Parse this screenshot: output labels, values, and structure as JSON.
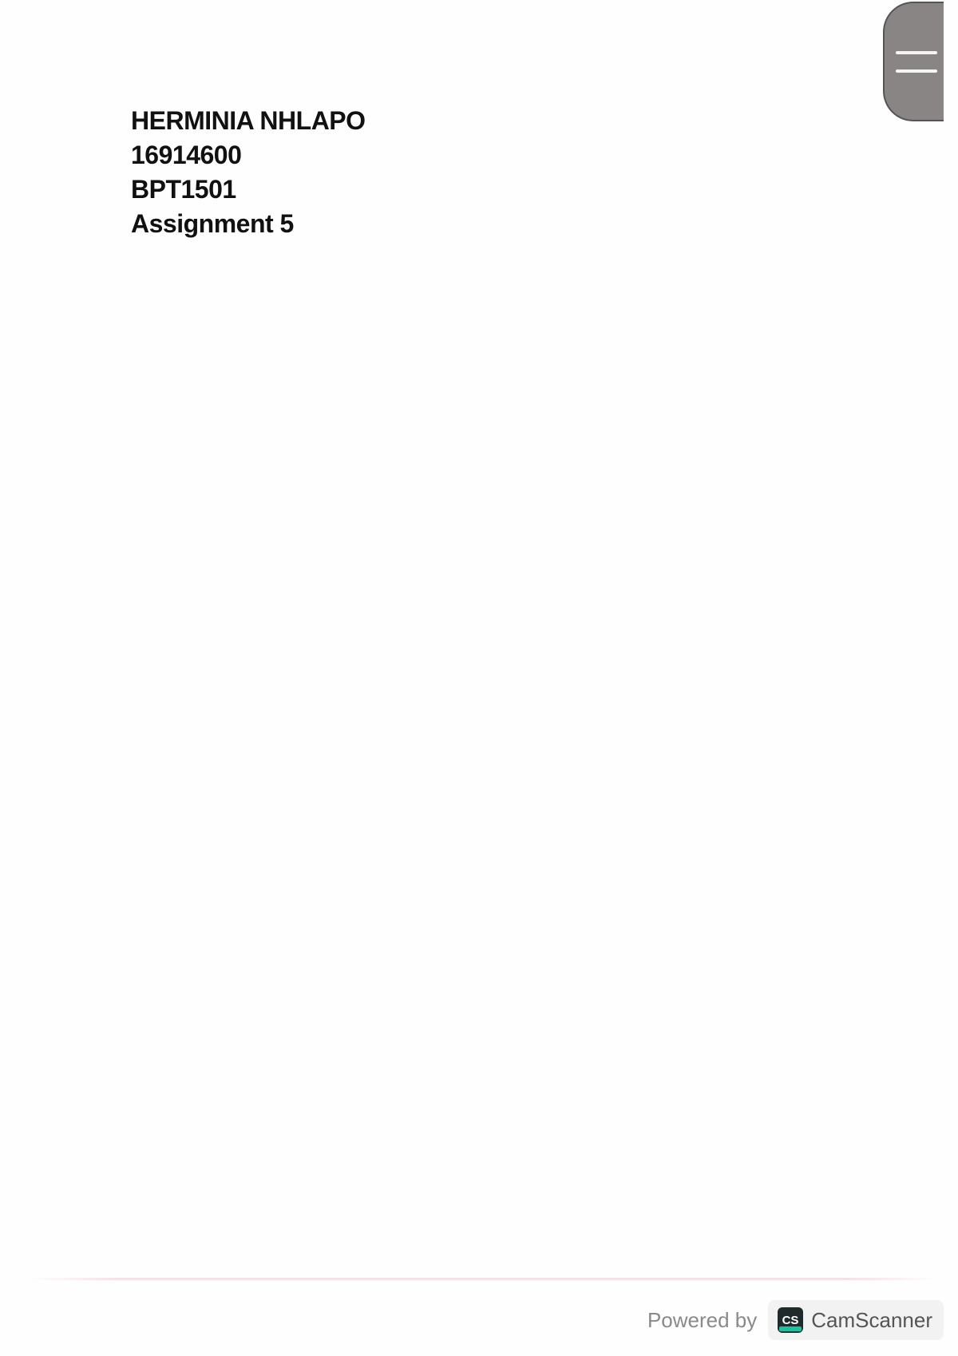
{
  "document": {
    "lines": [
      "HERMINIA NHLAPO",
      "16914600",
      "BPT1501",
      "Assignment 5"
    ]
  },
  "footer": {
    "powered_by": "Powered by",
    "brand": "CamScanner",
    "logo_text": "CS",
    "logo_color": "#1f2a2a",
    "logo_accent": "#19c2a0"
  },
  "menu_handle": {
    "icon": "hamburger-menu-icon",
    "color": "#8a8585"
  }
}
